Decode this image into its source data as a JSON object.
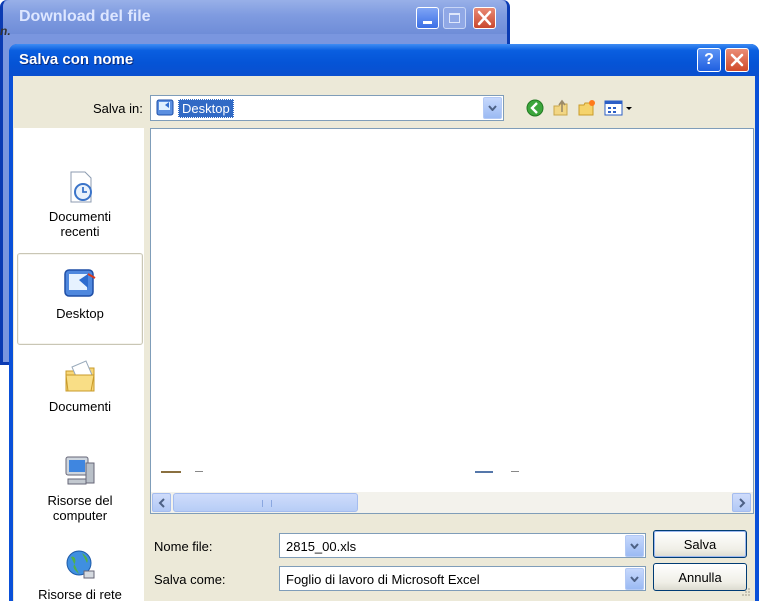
{
  "background_window": {
    "title": "Download del file",
    "left_partial_text": "n."
  },
  "dialog": {
    "title": "Salva con nome",
    "help_glyph": "?",
    "close_glyph": "✕"
  },
  "save_in": {
    "label": "Salva in:",
    "value": "Desktop"
  },
  "places_bar": [
    {
      "id": "recent",
      "label_line1": "Documenti",
      "label_line2": "recenti",
      "icon": "recent-documents-icon"
    },
    {
      "id": "desktop",
      "label_line1": "Desktop",
      "label_line2": "",
      "icon": "desktop-icon",
      "selected": true
    },
    {
      "id": "documents",
      "label_line1": "Documenti",
      "label_line2": "",
      "icon": "my-documents-icon"
    },
    {
      "id": "computer",
      "label_line1": "Risorse del",
      "label_line2": "computer",
      "icon": "my-computer-icon"
    },
    {
      "id": "network",
      "label_line1": "Risorse di rete",
      "label_line2": "",
      "icon": "network-places-icon"
    }
  ],
  "file_name": {
    "label": "Nome file:",
    "value": "2815_00.xls"
  },
  "save_as_type": {
    "label": "Salva come:",
    "value": "Foglio di lavoro di Microsoft Excel"
  },
  "buttons": {
    "save": "Salva",
    "cancel": "Annulla"
  },
  "colors": {
    "title_blue": "#0554d6",
    "dialog_face": "#ece9d8",
    "selection": "#316ac5"
  }
}
